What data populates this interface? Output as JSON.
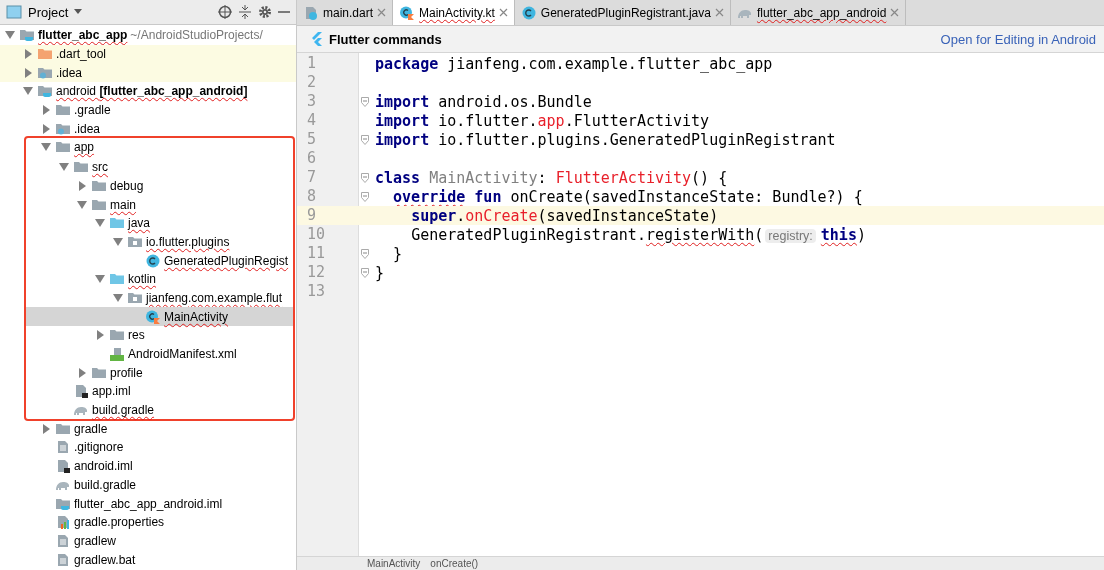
{
  "project_panel": {
    "title": "Project"
  },
  "tree": [
    {
      "label": "**flutter_abc_app**",
      "path": "~/AndroidStudioProjects/",
      "kind": "module",
      "expanded": true,
      "selected": false,
      "flagged": true,
      "children": [
        {
          "label": ".dart_tool",
          "kind": "folder-excluded",
          "expanded": false,
          "selected": false,
          "flagged": false,
          "excluded": true
        },
        {
          "label": ".idea",
          "kind": "folder-idea",
          "expanded": false,
          "selected": false,
          "flagged": false,
          "excluded": true
        },
        {
          "label": "android **[flutter_abc_app_android]**",
          "kind": "module",
          "expanded": true,
          "selected": false,
          "flagged": true,
          "children": [
            {
              "label": ".gradle",
              "kind": "folder",
              "expanded": false,
              "selected": false,
              "flagged": false
            },
            {
              "label": ".idea",
              "kind": "folder-idea",
              "expanded": false,
              "selected": false,
              "flagged": false
            },
            {
              "label": "app",
              "kind": "folder",
              "expanded": true,
              "selected": false,
              "flagged": true,
              "boxed": true,
              "children": [
                {
                  "label": "src",
                  "kind": "folder",
                  "expanded": true,
                  "selected": false,
                  "flagged": true,
                  "children": [
                    {
                      "label": "debug",
                      "kind": "folder",
                      "expanded": false,
                      "selected": false,
                      "flagged": false
                    },
                    {
                      "label": "main",
                      "kind": "folder",
                      "expanded": true,
                      "selected": false,
                      "flagged": true,
                      "children": [
                        {
                          "label": "java",
                          "kind": "source-folder",
                          "expanded": true,
                          "selected": false,
                          "flagged": true,
                          "children": [
                            {
                              "label": "io.flutter.plugins",
                              "kind": "package",
                              "expanded": true,
                              "selected": false,
                              "flagged": true,
                              "children": [
                                {
                                  "label": "GeneratedPluginRegist",
                                  "kind": "class-java",
                                  "selected": false,
                                  "flagged": true
                                }
                              ]
                            }
                          ]
                        },
                        {
                          "label": "kotlin",
                          "kind": "source-folder",
                          "expanded": true,
                          "selected": false,
                          "flagged": true,
                          "children": [
                            {
                              "label": "jianfeng.com.example.flut",
                              "kind": "package",
                              "expanded": true,
                              "selected": false,
                              "flagged": true,
                              "children": [
                                {
                                  "label": "MainActivity",
                                  "kind": "class-kotlin",
                                  "selected": true,
                                  "flagged": true
                                }
                              ]
                            }
                          ]
                        },
                        {
                          "label": "res",
                          "kind": "folder",
                          "expanded": false,
                          "selected": false,
                          "flagged": false
                        },
                        {
                          "label": "AndroidManifest.xml",
                          "kind": "manifest",
                          "selected": false,
                          "flagged": false
                        }
                      ]
                    },
                    {
                      "label": "profile",
                      "kind": "folder",
                      "expanded": false,
                      "selected": false,
                      "flagged": false
                    }
                  ]
                },
                {
                  "label": "app.iml",
                  "kind": "iml",
                  "selected": false,
                  "flagged": false
                },
                {
                  "label": "build.gradle",
                  "kind": "gradle",
                  "selected": false,
                  "flagged": true
                }
              ]
            },
            {
              "label": "gradle",
              "kind": "folder",
              "expanded": false,
              "selected": false,
              "flagged": false
            },
            {
              "label": ".gitignore",
              "kind": "text",
              "selected": false,
              "flagged": false
            },
            {
              "label": "android.iml",
              "kind": "iml",
              "selected": false,
              "flagged": false
            },
            {
              "label": "build.gradle",
              "kind": "gradle",
              "selected": false,
              "flagged": false
            },
            {
              "label": "flutter_abc_app_android.iml",
              "kind": "module-file",
              "selected": false,
              "flagged": false
            },
            {
              "label": "gradle.properties",
              "kind": "properties",
              "selected": false,
              "flagged": false
            },
            {
              "label": "gradlew",
              "kind": "text",
              "selected": false,
              "flagged": false
            },
            {
              "label": "gradlew.bat",
              "kind": "text",
              "selected": false,
              "flagged": false
            }
          ]
        }
      ]
    }
  ],
  "tabs": [
    {
      "label": "main.dart",
      "kind": "dart",
      "selected": false,
      "flagged": false
    },
    {
      "label": "MainActivity.kt",
      "kind": "class-kotlin",
      "selected": true,
      "flagged": true
    },
    {
      "label": "GeneratedPluginRegistrant.java",
      "kind": "class-java",
      "selected": false,
      "flagged": false
    },
    {
      "label": "flutter_abc_app_android",
      "kind": "gradle",
      "selected": false,
      "flagged": true
    }
  ],
  "flutter_bar": {
    "title": "Flutter commands",
    "link": "Open for Editing in Android"
  },
  "code": [
    {
      "number": "1",
      "fold": false,
      "current": false,
      "tokens": [
        {
          "kind": "keyword",
          "text": "package"
        },
        {
          "kind": "plain",
          "text": " jianfeng.com.example.flutter_abc_app"
        }
      ]
    },
    {
      "number": "2",
      "fold": false,
      "current": false
    },
    {
      "number": "3",
      "fold": true,
      "current": false,
      "tokens": [
        {
          "kind": "keyword",
          "text": "import"
        },
        {
          "kind": "plain",
          "text": " android.os.Bundle"
        }
      ]
    },
    {
      "number": "4",
      "fold": false,
      "current": false,
      "tokens": [
        {
          "kind": "keyword",
          "text": "import"
        },
        {
          "kind": "plain",
          "text": " io.flutter."
        },
        {
          "kind": "error",
          "text": "app"
        },
        {
          "kind": "plain",
          "text": ".FlutterActivity"
        }
      ]
    },
    {
      "number": "5",
      "fold": true,
      "current": false,
      "tokens": [
        {
          "kind": "keyword",
          "text": "import"
        },
        {
          "kind": "plain",
          "text": " io.flutter.plugins.GeneratedPluginRegistrant"
        }
      ]
    },
    {
      "number": "6",
      "fold": false,
      "current": false
    },
    {
      "number": "7",
      "fold": true,
      "current": false,
      "tokens": [
        {
          "kind": "keyword",
          "text": "class"
        },
        {
          "kind": "unused",
          "text": " MainActivity"
        },
        {
          "kind": "plain",
          "text": ": "
        },
        {
          "kind": "error",
          "text": "FlutterActivity"
        },
        {
          "kind": "plain",
          "text": "() {"
        }
      ]
    },
    {
      "number": "8",
      "fold": true,
      "current": false,
      "tokens": [
        {
          "kind": "keyword",
          "text": "  override",
          "flagged": true
        },
        {
          "kind": "keyword",
          "text": " fun"
        },
        {
          "kind": "plain",
          "text": " onCreate(savedInstanceState: Bundle?) {"
        }
      ]
    },
    {
      "number": "9",
      "fold": false,
      "current": true,
      "tokens": [
        {
          "kind": "keyword",
          "text": "    super"
        },
        {
          "kind": "plain",
          "text": "."
        },
        {
          "kind": "error",
          "text": "onCreate"
        },
        {
          "kind": "plain",
          "text": "(savedInstanceState)"
        }
      ]
    },
    {
      "number": "10",
      "fold": false,
      "current": false,
      "tokens": [
        {
          "kind": "plain",
          "text": "    GeneratedPluginRegistrant."
        },
        {
          "kind": "plain",
          "text": "registerWith",
          "flagged": true
        },
        {
          "kind": "plain",
          "text": "("
        },
        {
          "kind": "hint",
          "text": "registry:"
        },
        {
          "kind": "keyword",
          "text": "this",
          "flagged": true
        },
        {
          "kind": "plain",
          "text": ")"
        }
      ]
    },
    {
      "number": "11",
      "fold": true,
      "current": false,
      "tokens": [
        {
          "kind": "plain",
          "text": "  }"
        }
      ]
    },
    {
      "number": "12",
      "fold": true,
      "current": false,
      "tokens": [
        {
          "kind": "plain",
          "text": "}"
        }
      ]
    },
    {
      "number": "13",
      "fold": false,
      "current": false
    }
  ],
  "breadcrumb": [
    "MainActivity",
    "onCreate()"
  ]
}
